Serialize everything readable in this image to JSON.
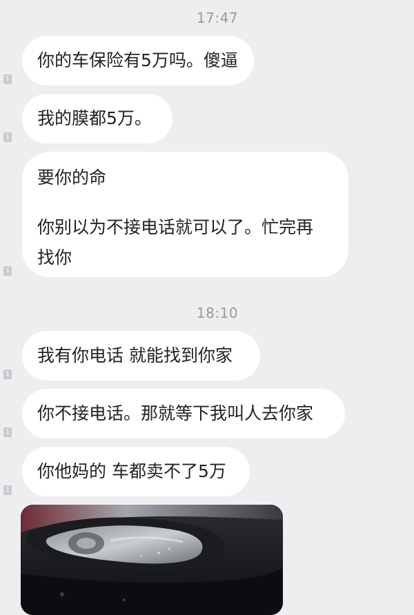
{
  "timestamps": [
    "17:47",
    "18:10"
  ],
  "messages": [
    {
      "lines": [
        "你的车保险有5万吗。傻逼"
      ],
      "marker": "1"
    },
    {
      "lines": [
        "我的膜都5万。"
      ],
      "marker": "1"
    },
    {
      "lines": [
        "要你的命",
        "",
        "你别以为不接电话就可以了。忙完再",
        "找你"
      ],
      "marker": "1"
    },
    {
      "lines": [
        "我有你电话 就能找到你家"
      ],
      "marker": "1"
    },
    {
      "lines": [
        "你不接电话。那就等下我叫人去你家"
      ],
      "marker": "1"
    },
    {
      "lines": [
        "你他妈的 车都卖不了5万"
      ],
      "marker": "1"
    }
  ],
  "image_message": {
    "kind": "car-headlight-photo"
  }
}
